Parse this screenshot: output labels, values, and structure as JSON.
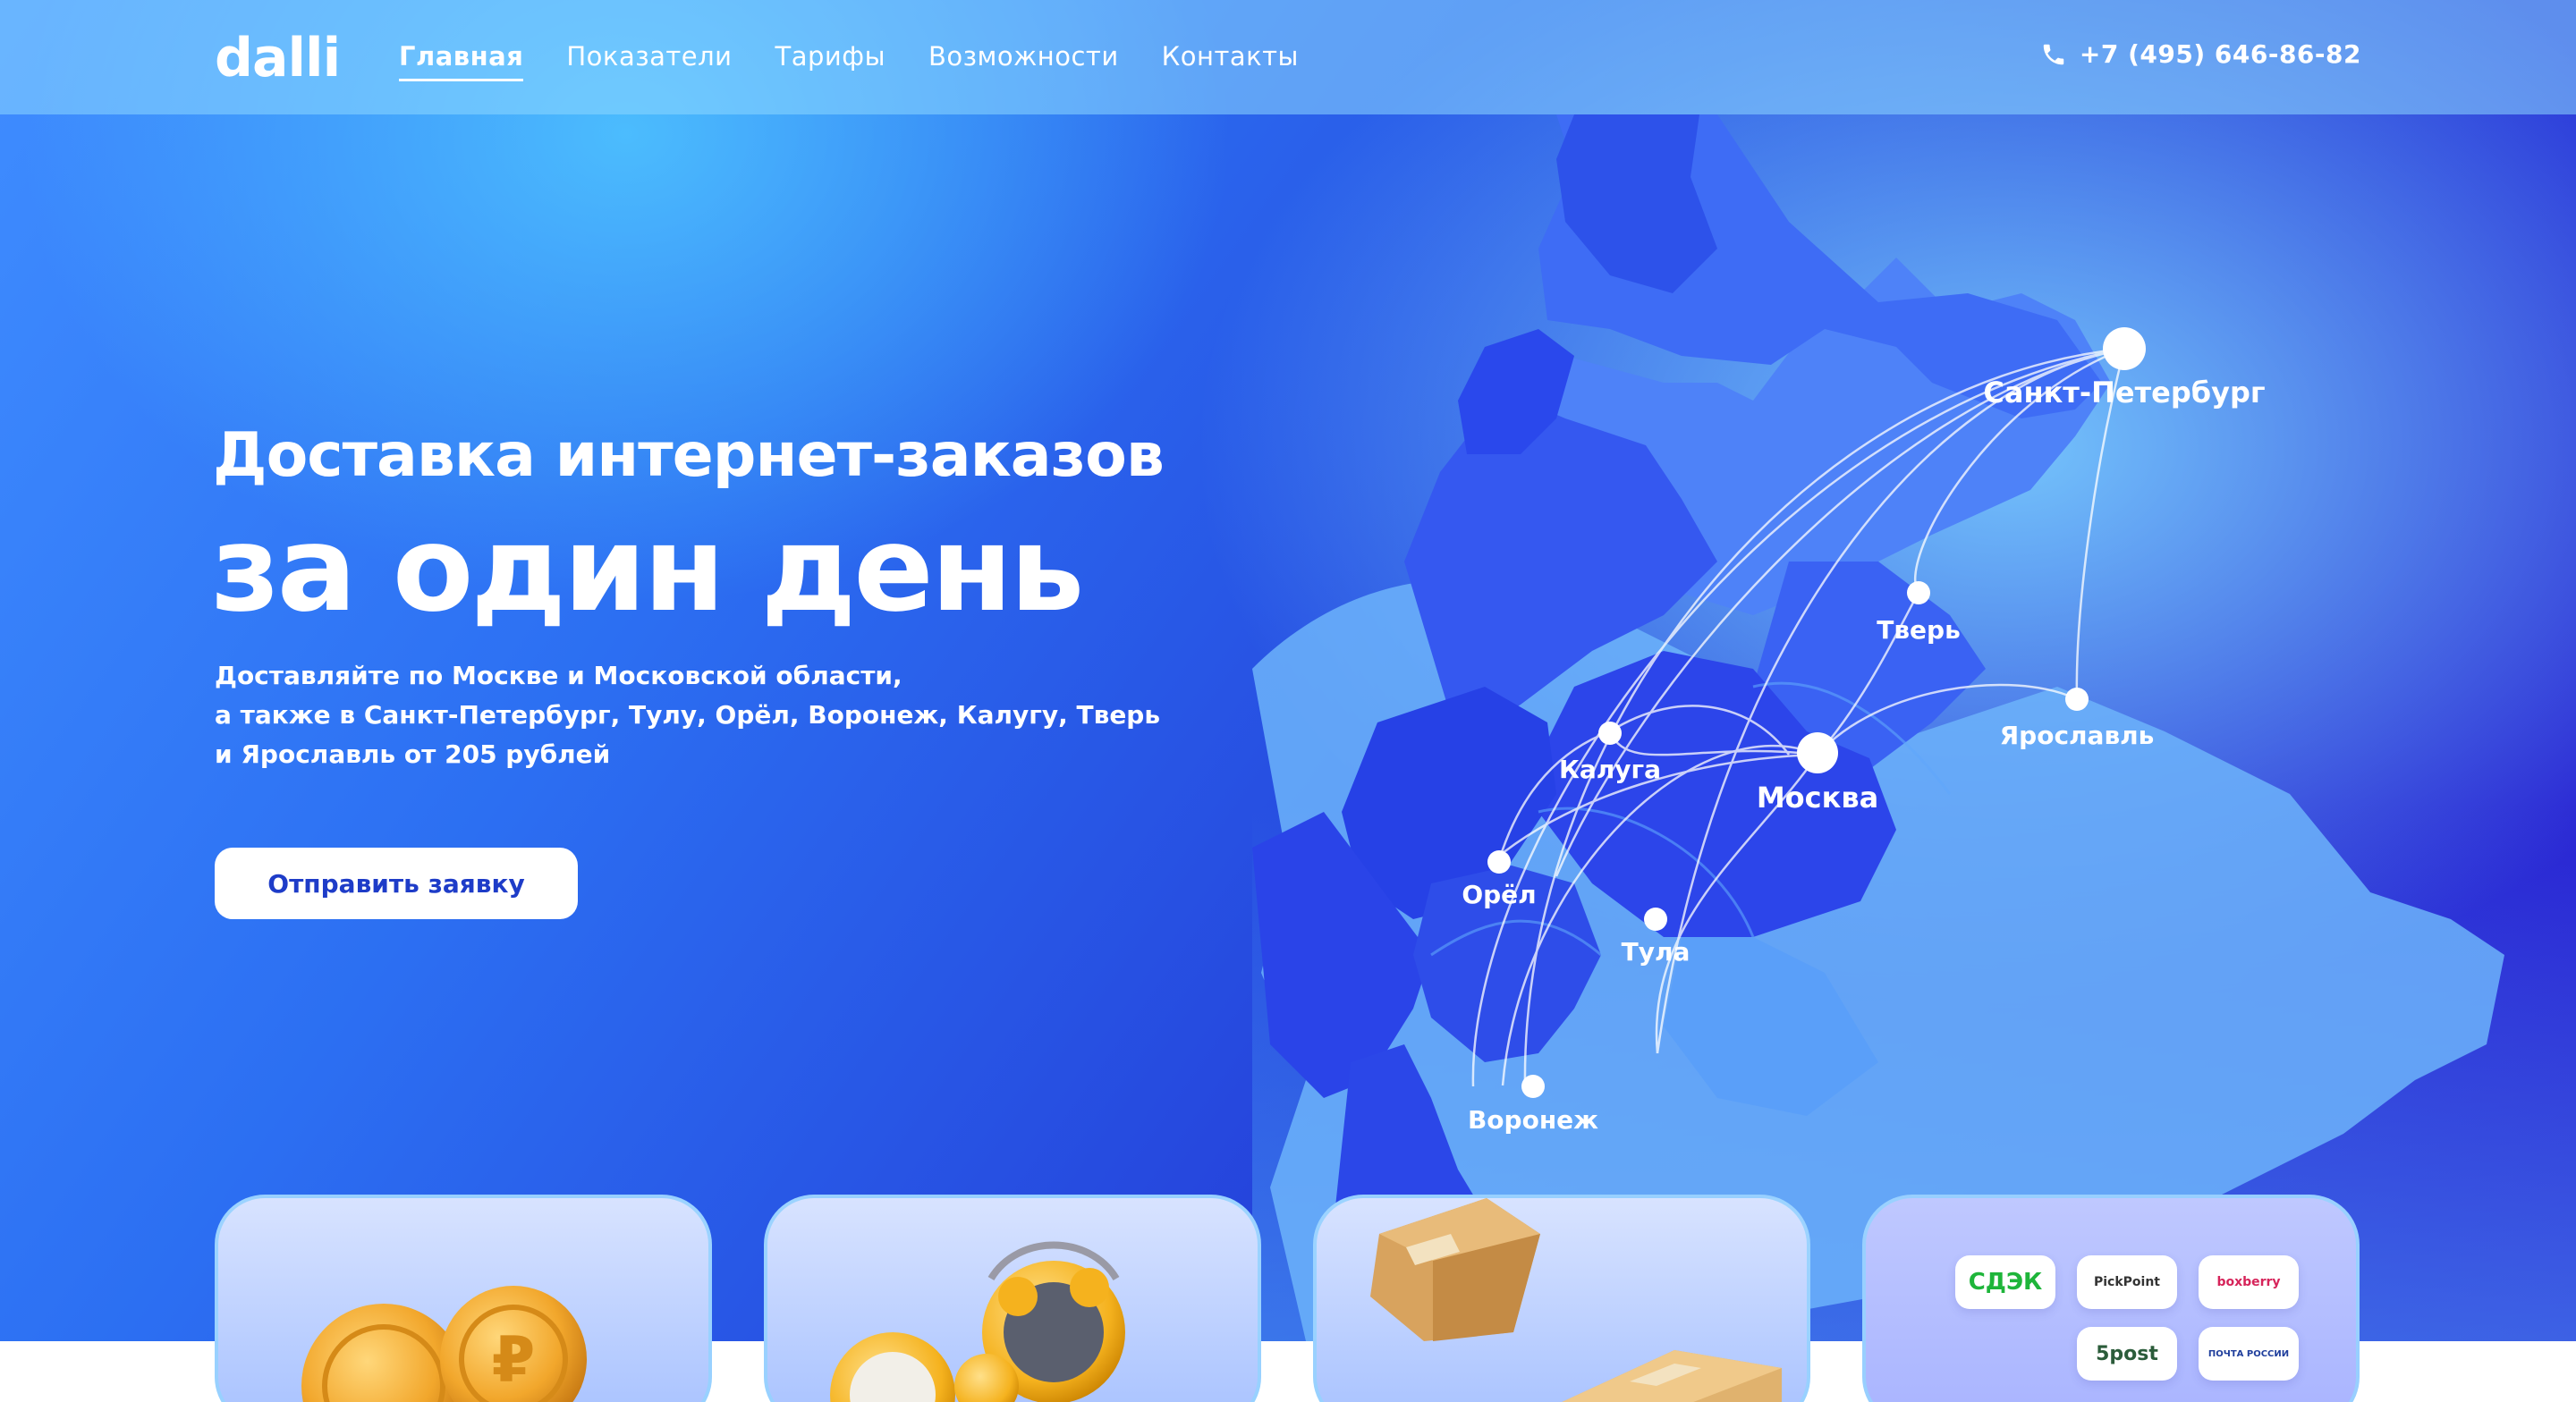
{
  "header": {
    "logo": "dalli",
    "nav": [
      {
        "label": "Главная",
        "active": true
      },
      {
        "label": "Показатели",
        "active": false
      },
      {
        "label": "Тарифы",
        "active": false
      },
      {
        "label": "Возможности",
        "active": false
      },
      {
        "label": "Контакты",
        "active": false
      }
    ],
    "phone": "+7 (495) 646-86-82"
  },
  "hero": {
    "title_line1": "Доставка интернет-заказов",
    "title_line2": "за один день",
    "subtitle": [
      "Доставляйте по Москве и Московской области,",
      "а также в Санкт-Петербург, Тулу, Орёл, Воронеж, Калугу, Тверь",
      "и Ярославль от 205 рублей"
    ],
    "cta_label": "Отправить заявку"
  },
  "map": {
    "cities": [
      "Санкт-Петербург",
      "Тверь",
      "Ярославль",
      "Москва",
      "Калуга",
      "Орёл",
      "Тула",
      "Воронеж"
    ]
  },
  "cards": [
    {
      "icon": "coins-icon"
    },
    {
      "icon": "alarm-clock-icon"
    },
    {
      "icon": "parcel-box-icon"
    },
    {
      "partners": [
        "СДЭК",
        "PickPoint",
        "boxberry",
        "5post",
        "ПОЧТА РОССИИ"
      ]
    }
  ],
  "colors": {
    "accent": "#1e3cc8",
    "region_dark": "#2a4df2",
    "region_mid": "#4f8cf8",
    "region_light": "#7fbdfb"
  }
}
